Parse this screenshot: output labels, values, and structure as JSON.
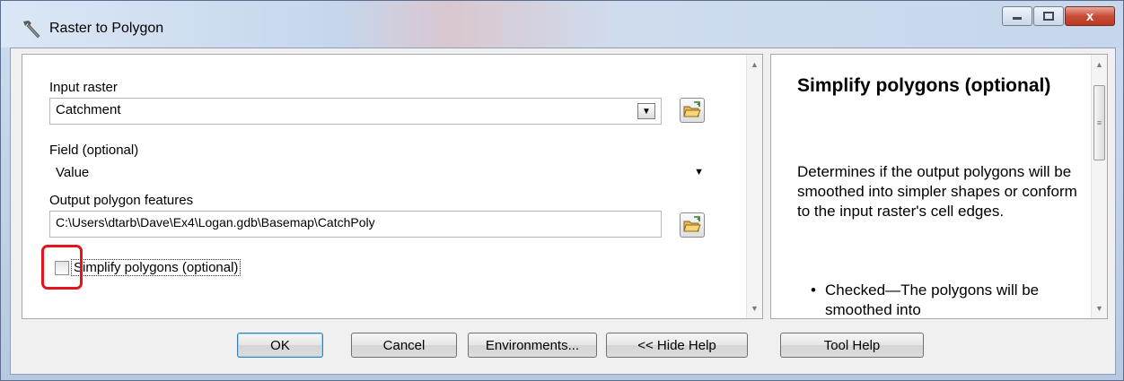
{
  "window": {
    "title": "Raster to Polygon",
    "icon": "hammer-icon",
    "controls": {
      "minimize_icon": "minimize-icon",
      "maximize_icon": "maximize-icon",
      "close_label": "x"
    }
  },
  "params": {
    "input_raster": {
      "label": "Input raster",
      "value": "Catchment",
      "browse_icon": "open-folder-icon"
    },
    "field": {
      "label": "Field (optional)",
      "value": "Value"
    },
    "output": {
      "label": "Output polygon features",
      "value": "C:\\Users\\dtarb\\Dave\\Ex4\\Logan.gdb\\Basemap\\CatchPoly",
      "browse_icon": "open-folder-icon"
    },
    "simplify": {
      "label": "Simplify polygons (optional)",
      "checked": false
    }
  },
  "help": {
    "title": "Simplify polygons (optional)",
    "description": "Determines if the output polygons will be smoothed into simpler shapes or conform to the input raster's cell edges.",
    "bullet": "Checked—The polygons will be smoothed into"
  },
  "buttons": {
    "ok": "OK",
    "cancel": "Cancel",
    "environments": "Environments...",
    "hide_help": "<< Hide Help",
    "tool_help": "Tool Help"
  },
  "colors": {
    "highlight": "#e0161c",
    "close_button": "#c94c36"
  }
}
